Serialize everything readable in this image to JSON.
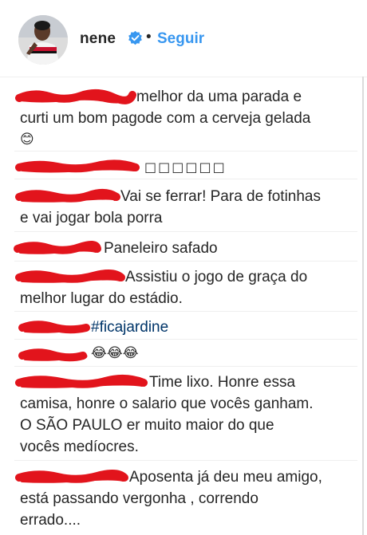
{
  "header": {
    "username": "nene",
    "separator": "•",
    "follow_label": "Seguir"
  },
  "colors": {
    "link_blue": "#3897f0",
    "hashtag": "#003569",
    "redaction_red": "#e2141c",
    "text": "#262626"
  },
  "comments": [
    {
      "lines": [
        "melhor da uma parada e",
        "curti um bom pagode com a cerveja gelada",
        "😊"
      ]
    },
    {
      "lines": [
        "□□□□□□"
      ]
    },
    {
      "lines": [
        "Vai se ferrar! Para de fotinhas",
        "e vai jogar bola porra"
      ]
    },
    {
      "lines": [
        "Paneleiro safado"
      ]
    },
    {
      "lines": [
        "Assistiu o jogo de graça do",
        "melhor lugar do estádio."
      ]
    },
    {
      "lines": [
        "#ficajardine"
      ]
    },
    {
      "lines": [
        "😂😂😂"
      ]
    },
    {
      "lines": [
        "Time lixo. Honre essa",
        "camisa, honre o salario que vocês ganham.",
        "O SÃO PAULO er muito maior do que",
        "vocês medíocres."
      ]
    },
    {
      "lines": [
        "Aposenta já deu meu amigo,",
        "está passando vergonha , correndo",
        "errado...."
      ]
    }
  ]
}
